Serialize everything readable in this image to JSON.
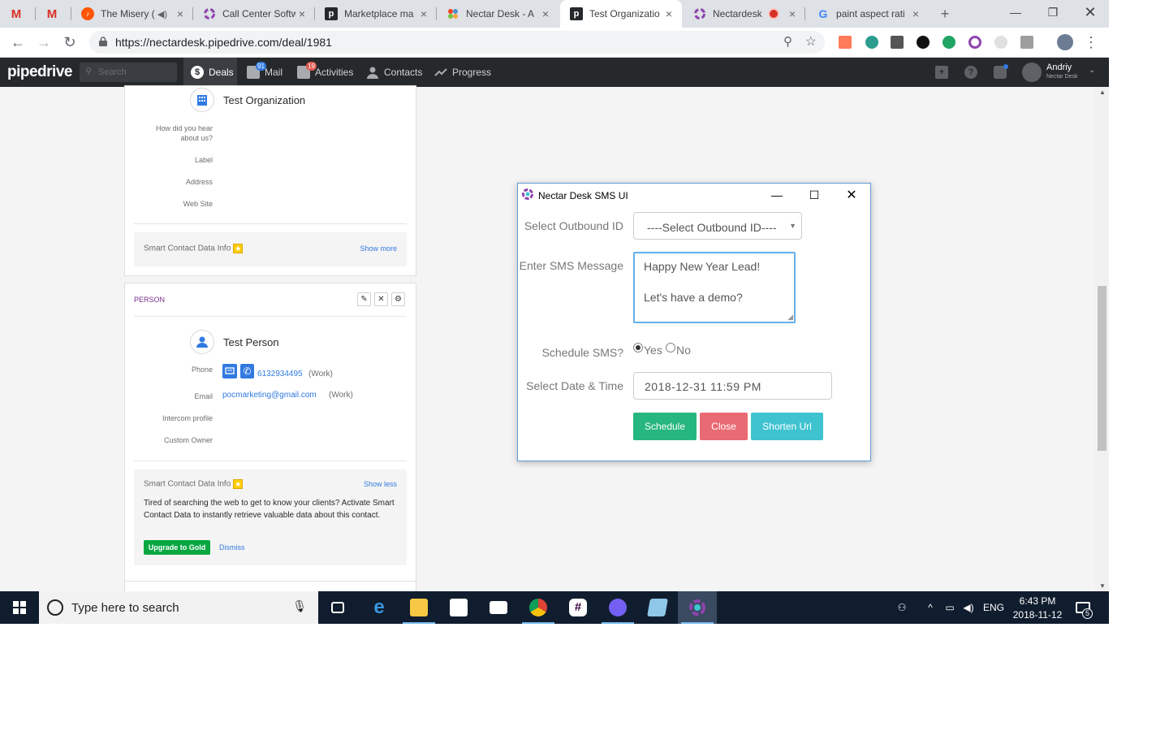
{
  "browser": {
    "tabs": [
      {
        "title": "",
        "icon": "gmail-icon"
      },
      {
        "title": "",
        "icon": "gmail-icon"
      },
      {
        "title": "The Misery (",
        "icon": "music-icon"
      },
      {
        "title": "Call Center Softw",
        "icon": "nectardesk-icon"
      },
      {
        "title": "Marketplace ma",
        "icon": "pipedrive-icon"
      },
      {
        "title": "Nectar Desk - A",
        "icon": "joomla-icon"
      },
      {
        "title": "Test Organizatio",
        "icon": "pipedrive-icon"
      },
      {
        "title": "Nectardesk",
        "icon": "nectardesk-icon"
      },
      {
        "title": "paint aspect rati",
        "icon": "google-icon"
      }
    ],
    "url": "https://nectardesk.pipedrive.com/deal/1981"
  },
  "pipedrive": {
    "logo": "pipedrive",
    "search_placeholder": "Search",
    "nav": [
      {
        "label": "Deals",
        "badge": ""
      },
      {
        "label": "Mail",
        "badge": "91"
      },
      {
        "label": "Activities",
        "badge": "19"
      },
      {
        "label": "Contacts",
        "badge": ""
      },
      {
        "label": "Progress",
        "badge": ""
      }
    ],
    "user_name": "Andriy",
    "user_company": "Nectar Desk"
  },
  "organization": {
    "name": "Test Organization",
    "fields": [
      "How did you hear about us?",
      "Label",
      "Address",
      "Web Site"
    ],
    "smart_title": "Smart Contact Data Info",
    "show_more": "Show more"
  },
  "person": {
    "section_title": "PERSON",
    "name": "Test Person",
    "phone_label": "Phone",
    "phone": "6132934495",
    "phone_type": "(Work)",
    "email_label": "Email",
    "email": "pocmarketing@gmail.com",
    "email_type": "(Work)",
    "intercom_label": "Intercom profile",
    "owner_label": "Custom Owner",
    "smart_title": "Smart Contact Data Info",
    "show_less": "Show less",
    "smart_text": "Tired of searching the web to get to know your clients? Activate Smart Contact Data to instantly retrieve valuable data about this contact.",
    "upgrade": "Upgrade to Gold",
    "dismiss": "Dismiss"
  },
  "sms_dialog": {
    "title": "Nectar Desk SMS UI",
    "outbound_label": "Select Outbound ID",
    "outbound_value": "----Select Outbound ID----",
    "message_label": "Enter SMS Message",
    "message_line1": "Happy New Year Lead!",
    "message_line2": "Let's have a demo?",
    "schedule_label": "Schedule SMS?",
    "yes": "Yes",
    "no": "No",
    "schedule_selected": "Yes",
    "date_label": "Select Date & Time",
    "date_value": "2018-12-31 11:59 PM",
    "btn_schedule": "Schedule",
    "btn_close": "Close",
    "btn_shorten": "Shorten Url",
    "colors": {
      "schedule": "#26b67f",
      "close": "#e96a73",
      "shorten": "#3fc3d0"
    }
  },
  "taskbar": {
    "search_placeholder": "Type here to search",
    "lang": "ENG",
    "time": "6:43 PM",
    "date": "2018-11-12",
    "notifications": "5"
  }
}
